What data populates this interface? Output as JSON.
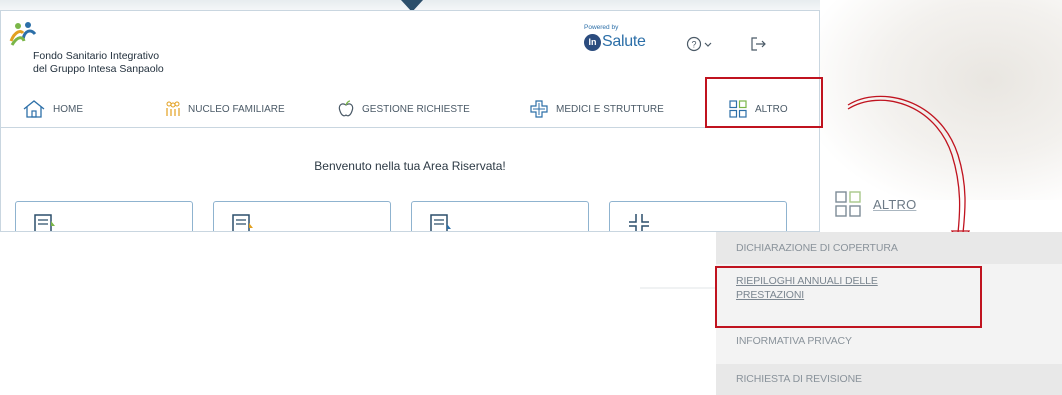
{
  "brand": {
    "line1": "Fondo Sanitario Integrativo",
    "line2": "del Gruppo Intesa Sanpaolo"
  },
  "powered": {
    "label": "Powered by",
    "badge": "In",
    "name": "Salute"
  },
  "header_icons": [
    "help-icon",
    "chevron-down-icon",
    "logout-icon"
  ],
  "nav": {
    "home": "HOME",
    "family": "NUCLEO FAMILIARE",
    "requests": "GESTIONE RICHIESTE",
    "doctors": "MEDICI E STRUTTURE",
    "more": "ALTRO"
  },
  "main": {
    "welcome": "Benvenuto nella tua Area Riservata!"
  },
  "zoom": {
    "title": "ALTRO",
    "menu": [
      "DICHIARAZIONE DI COPERTURA",
      "RIEPILOGHI ANNUALI DELLE",
      "PRESTAZIONI",
      "INFORMATIVA PRIVACY",
      "RICHIESTA DI REVISIONE"
    ]
  },
  "colors": {
    "accent": "#2c6fa8",
    "highlight": "#c0131f",
    "border": "#8fb3cf",
    "text": "#4b5a67"
  }
}
